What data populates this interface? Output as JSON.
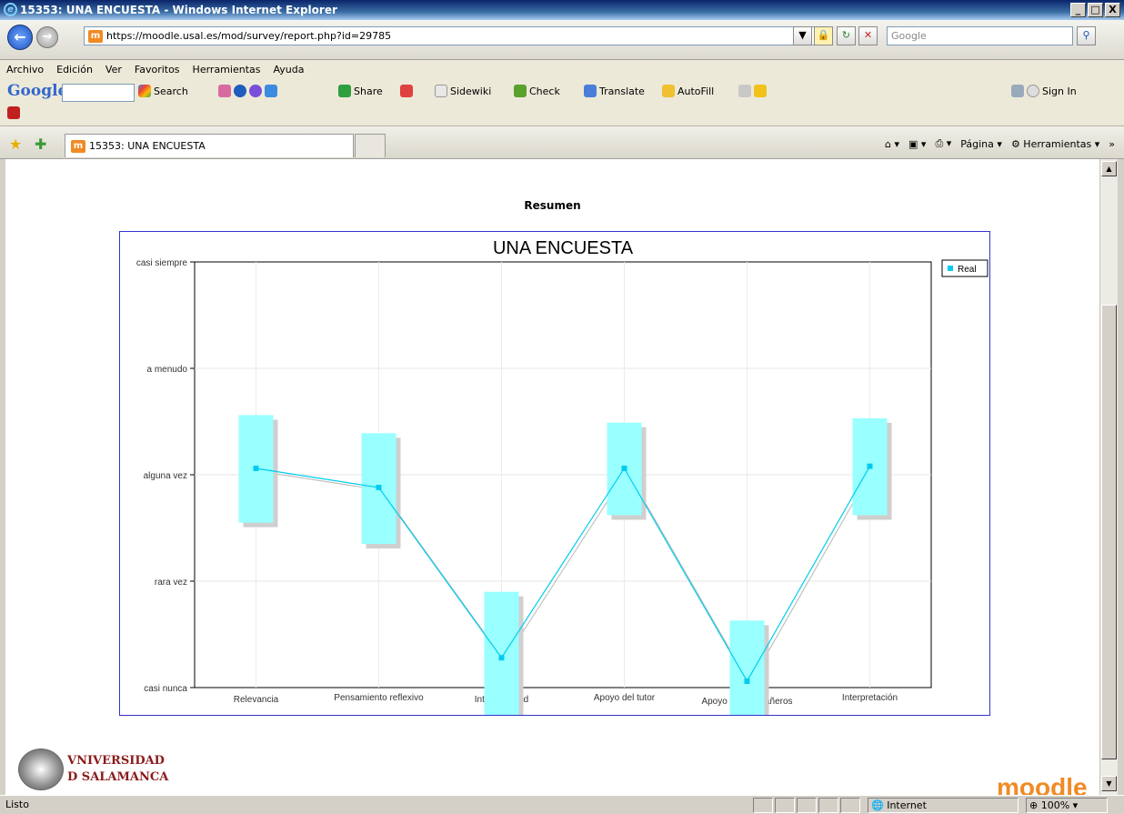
{
  "window": {
    "title": "15353: UNA ENCUESTA - Windows Internet Explorer",
    "min_label": "_",
    "max_label": "□",
    "close_label": "X"
  },
  "address": {
    "url": "https://moodle.usal.es/mod/survey/report.php?id=29785",
    "search_placeholder": "Google"
  },
  "menu": [
    "Archivo",
    "Edición",
    "Ver",
    "Favoritos",
    "Herramientas",
    "Ayuda"
  ],
  "google_toolbar": {
    "logo": "Google",
    "search_label": "Search",
    "share_label": "Share",
    "sidewiki_label": "Sidewiki",
    "check_label": "Check",
    "translate_label": "Translate",
    "autofill_label": "AutoFill",
    "signin_label": "Sign In"
  },
  "tabs": {
    "active_label": "15353: UNA ENCUESTA"
  },
  "command_bar": {
    "page_label": "Página",
    "tools_label": "Herramientas"
  },
  "page": {
    "heading": "Resumen",
    "university_line1": "VNIVERSIDAD",
    "university_line2": "D SALAMANCA",
    "moodle_logo": "moodle"
  },
  "chart_data": {
    "type": "line",
    "title": "UNA ENCUESTA",
    "categories": [
      "Relevancia",
      "Pensamiento reflexivo",
      "Interactividad",
      "Apoyo del tutor",
      "Apoyo de compañeros",
      "Interpretación"
    ],
    "y_tick_labels": [
      "casi nunca",
      "rara vez",
      "alguna vez",
      "a menudo",
      "casi siempre"
    ],
    "ylim": [
      1,
      5
    ],
    "series": [
      {
        "name": "Real",
        "values": [
          3.06,
          2.88,
          1.28,
          3.06,
          1.06,
          3.08
        ],
        "range_low": [
          2.55,
          2.35,
          0.69,
          2.62,
          0.55,
          2.62
        ],
        "range_high": [
          3.56,
          3.39,
          1.9,
          3.49,
          1.63,
          3.53
        ]
      }
    ],
    "legend_position": "top-right",
    "grid": true,
    "color": "#00ccee",
    "box_color": "#99ffff"
  },
  "status": {
    "left": "Listo",
    "zone": "Internet",
    "zoom": "100%"
  }
}
